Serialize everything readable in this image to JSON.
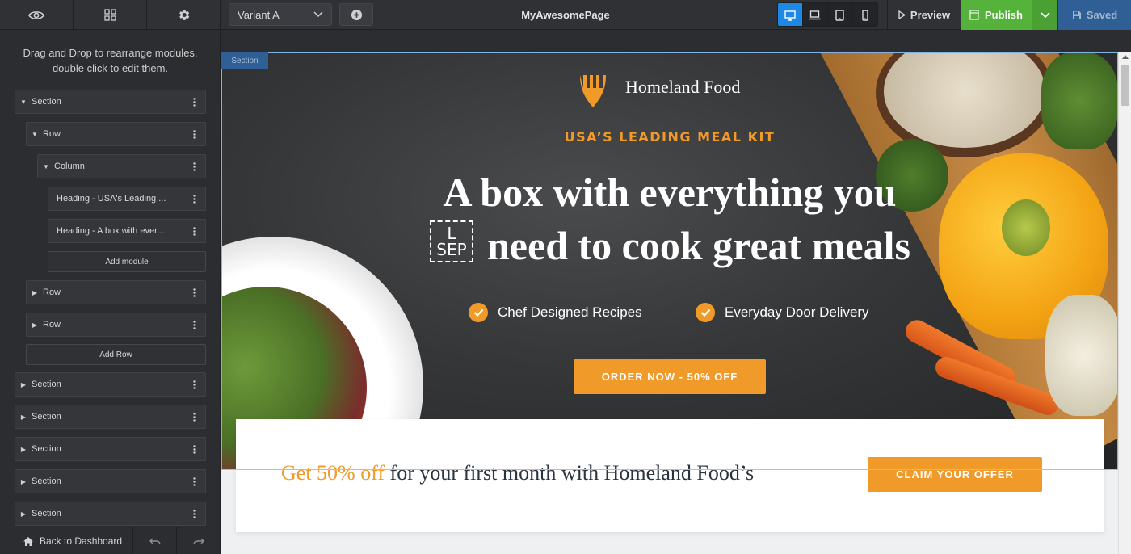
{
  "topbar": {
    "page_name": "MyAwesomePage",
    "variant": "Variant A",
    "preview_label": "Preview",
    "publish_label": "Publish",
    "saved_label": "Saved",
    "active_device": "desktop"
  },
  "sidebar": {
    "help_text": "Drag and Drop to rearrange modules, double click to edit them.",
    "tree": {
      "section_label": "Section",
      "row_label": "Row",
      "column_label": "Column",
      "heading_1": "Heading - USA's Leading ...",
      "heading_2": "Heading - A box with ever...",
      "add_module": "Add module",
      "add_row": "Add Row"
    },
    "back_label": "Back to Dashboard"
  },
  "canvas": {
    "section_tag": "Section",
    "brand": "Homeland Food",
    "kicker": "USA’S LEADING MEAL KIT",
    "headline_line1": "A box with everything you",
    "headline_line2": "need to cook great meals",
    "sep_top": "L",
    "sep_bottom": "SEP",
    "features": [
      "Chef Designed Recipes",
      "Everyday Door Delivery"
    ],
    "cta": "ORDER NOW - 50% OFF",
    "offer_highlight": "Get 50% off",
    "offer_rest": " for your first month with Homeland Food’s",
    "claim": "CLAIM YOUR OFFER"
  },
  "colors": {
    "accent": "#f09a29",
    "publish": "#55b23b",
    "saved": "#2f5f94",
    "device_active": "#1e88e5"
  }
}
